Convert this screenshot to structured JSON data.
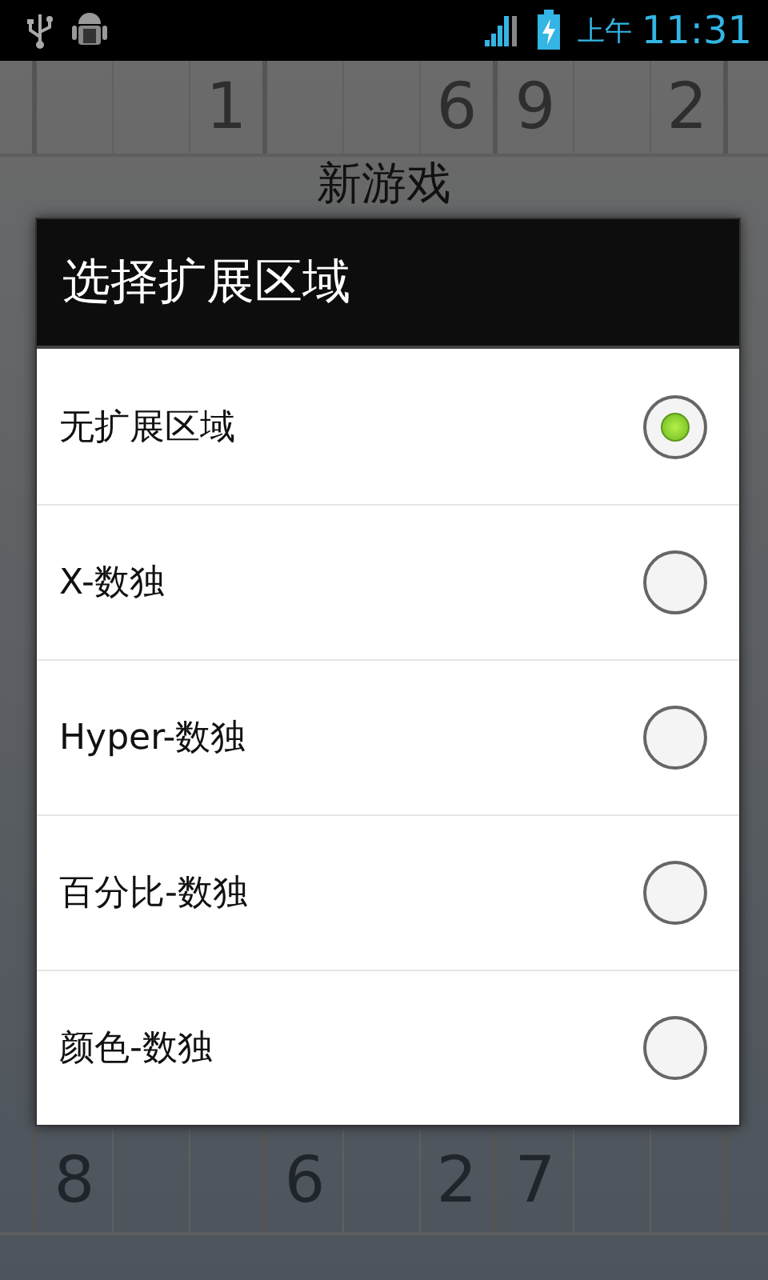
{
  "status_bar": {
    "time": "11:31",
    "period": "上午"
  },
  "background": {
    "title": "新游戏",
    "top_digits": [
      "1",
      "6",
      "9",
      "2"
    ],
    "bottom_digits": [
      "8",
      "6",
      "2",
      "7"
    ]
  },
  "dialog": {
    "title": "选择扩展区域",
    "options": [
      {
        "label": "无扩展区域",
        "selected": true
      },
      {
        "label": "X-数独",
        "selected": false
      },
      {
        "label": "Hyper-数独",
        "selected": false
      },
      {
        "label": "百分比-数独",
        "selected": false
      },
      {
        "label": "颜色-数独",
        "selected": false
      }
    ]
  }
}
